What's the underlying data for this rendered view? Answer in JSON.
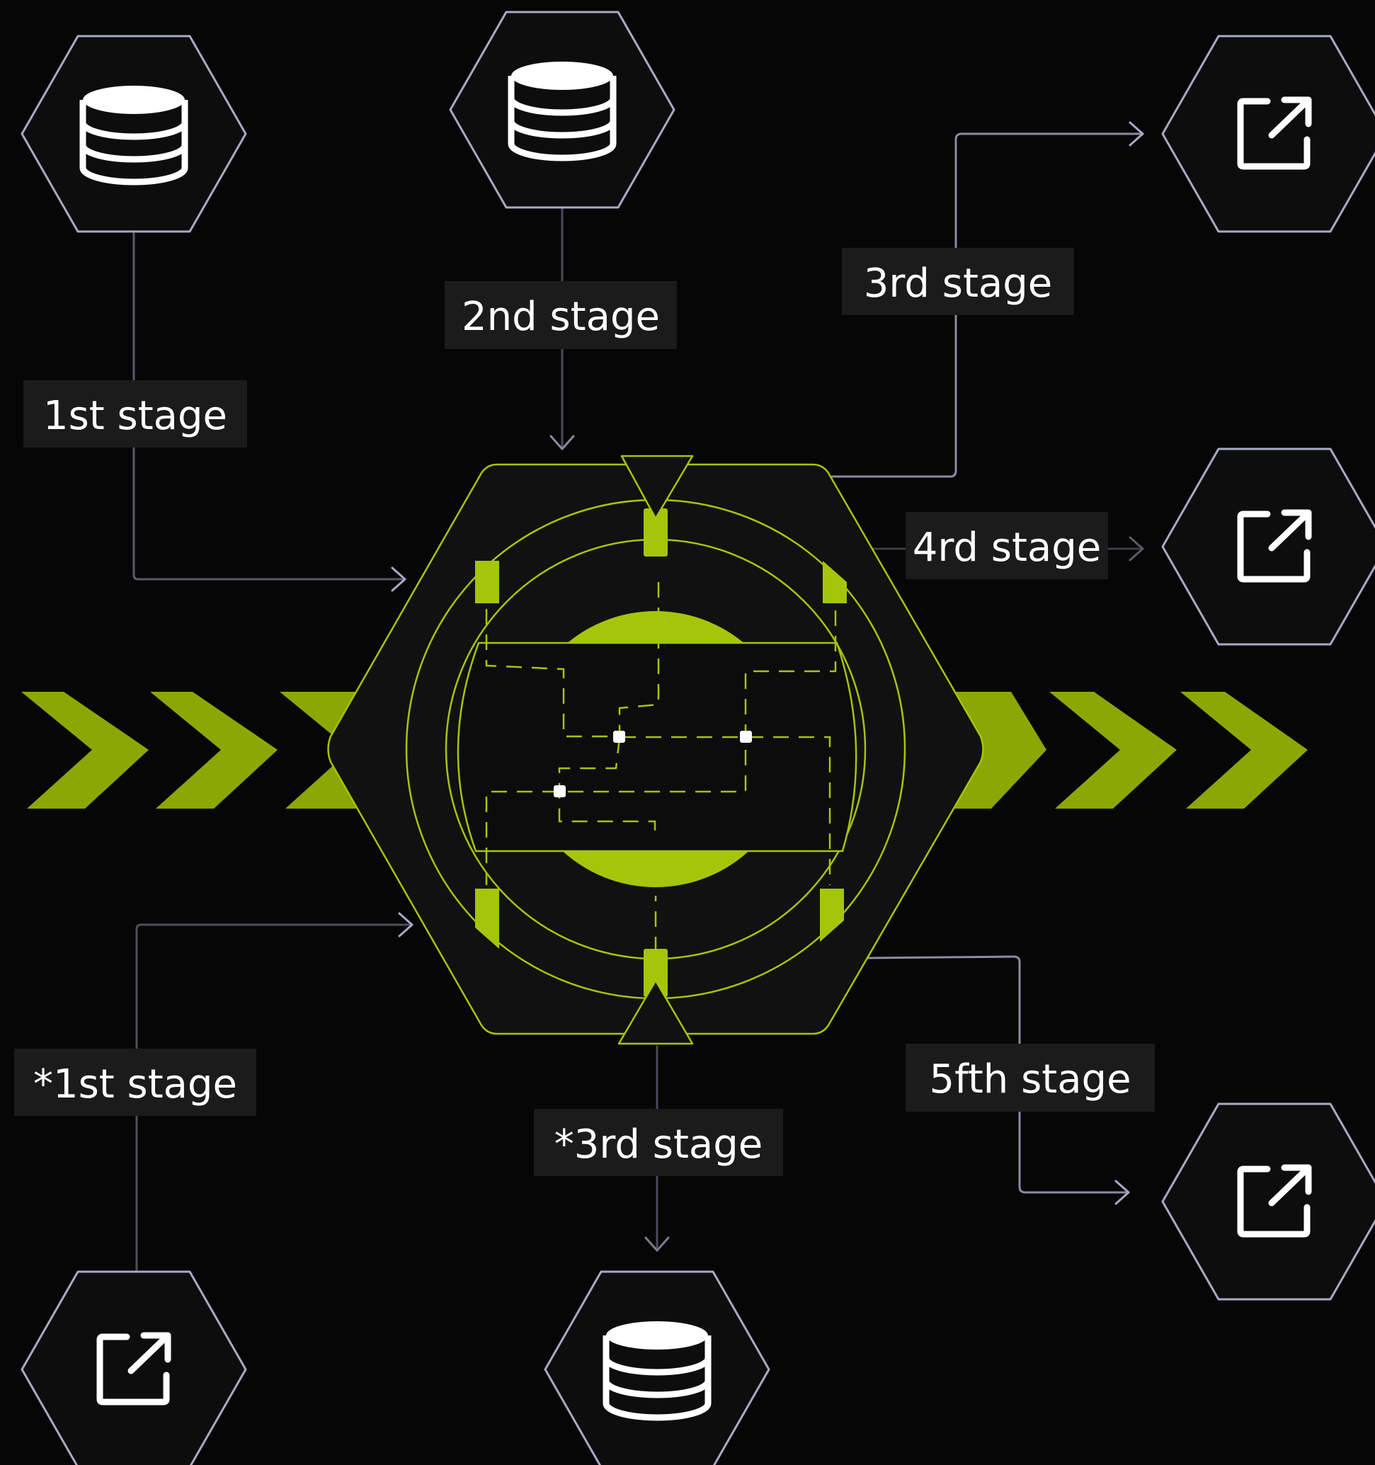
{
  "colors": {
    "background": "#060606",
    "node_fill": "#0d0d0d",
    "node_stroke": "#a8aac4",
    "connector": "#9a9cb4",
    "label_bg": "#1b1b1b",
    "label_text": "#ffffff",
    "accent": "#a3c60a",
    "accent_dark": "#8aa804",
    "core_fill": "#111111"
  },
  "labels": {
    "stage1": "1st stage",
    "stage2": "2nd stage",
    "stage3": "3rd stage",
    "stage4": "4rd stage",
    "stage1b": "*1st stage",
    "stage3b": "*3rd stage",
    "stage5": "5fth stage"
  },
  "nodes": [
    {
      "id": "source-db-1",
      "icon": "database-icon"
    },
    {
      "id": "source-db-2",
      "icon": "database-icon"
    },
    {
      "id": "output-1",
      "icon": "external-link-icon"
    },
    {
      "id": "output-2",
      "icon": "external-link-icon"
    },
    {
      "id": "output-3",
      "icon": "external-link-icon"
    },
    {
      "id": "output-4",
      "icon": "external-link-icon"
    },
    {
      "id": "sink-db",
      "icon": "database-icon"
    }
  ]
}
